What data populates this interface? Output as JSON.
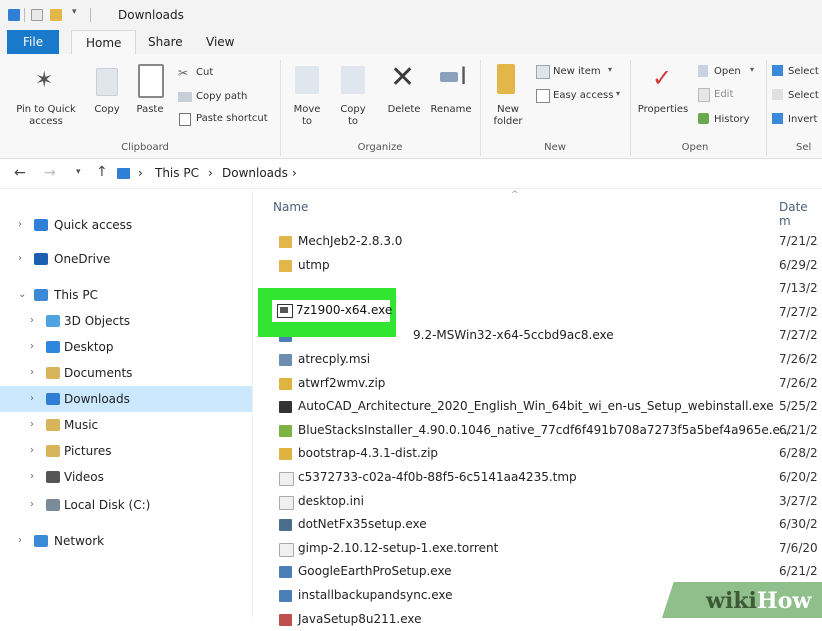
{
  "window": {
    "title": "Downloads"
  },
  "menu_tabs": [
    "File",
    "Home",
    "Share",
    "View"
  ],
  "ribbon": {
    "clipboard": {
      "pin_to_quick_access": "Pin to Quick access",
      "copy": "Copy",
      "paste": "Paste",
      "cut": "Cut",
      "copy_path": "Copy path",
      "paste_shortcut": "Paste shortcut",
      "group_label": "Clipboard"
    },
    "organize": {
      "move_to": "Move to",
      "copy_to": "Copy to",
      "delete": "Delete",
      "rename": "Rename",
      "group_label": "Organize"
    },
    "new": {
      "new_folder": "New folder",
      "new_item": "New item",
      "easy_access": "Easy access",
      "group_label": "New"
    },
    "open": {
      "properties": "Properties",
      "open": "Open",
      "edit": "Edit",
      "history": "History",
      "group_label": "Open"
    },
    "select": {
      "select_all": "Select",
      "select_none": "Select",
      "invert": "Invert",
      "group_label": "Sel"
    }
  },
  "address_bar": {
    "crumbs": [
      "This PC",
      "Downloads"
    ]
  },
  "nav_pane": [
    {
      "label": "Quick access",
      "icon": "star-icon",
      "color": "#2f7fd6"
    },
    {
      "label": "OneDrive",
      "icon": "cloud-icon",
      "color": "#1c5fb0"
    },
    {
      "label": "This PC",
      "icon": "computer-icon",
      "color": "#3b8ad8"
    },
    {
      "label": "3D Objects",
      "icon": "cube-icon",
      "color": "#4fa3e0"
    },
    {
      "label": "Desktop",
      "icon": "desktop-icon",
      "color": "#2e86de"
    },
    {
      "label": "Documents",
      "icon": "documents-icon",
      "color": "#d8b45a"
    },
    {
      "label": "Downloads",
      "icon": "downloads-icon",
      "color": "#2f7fd6"
    },
    {
      "label": "Music",
      "icon": "music-icon",
      "color": "#d8b45a"
    },
    {
      "label": "Pictures",
      "icon": "pictures-icon",
      "color": "#d8b45a"
    },
    {
      "label": "Videos",
      "icon": "videos-icon",
      "color": "#555555"
    },
    {
      "label": "Local Disk (C:)",
      "icon": "disk-icon",
      "color": "#7a8a99"
    },
    {
      "label": "Network",
      "icon": "network-icon",
      "color": "#3b8ad8"
    }
  ],
  "file_list": {
    "columns": {
      "name": "Name",
      "date": "Date m"
    },
    "rows": [
      {
        "name": "MechJeb2-2.8.3.0",
        "date": "7/21/2",
        "icon": "folder-icon",
        "color": "#e3b64a"
      },
      {
        "name": "utmp",
        "date": "6/29/2",
        "icon": "folder-icon",
        "color": "#e3b64a"
      },
      {
        "name": "",
        "date": "7/13/2",
        "icon": "",
        "color": "#ffffff"
      },
      {
        "name": "",
        "date": "7/27/2",
        "icon": "",
        "color": "#ffffff"
      },
      {
        "name": "9.2-MSWin32-x64-5ccbd9ac8.exe",
        "date": "7/27/2",
        "icon": "exe-icon",
        "color": "#4a7fb5"
      },
      {
        "name": "atrecply.msi",
        "date": "7/26/2",
        "icon": "installer-icon",
        "color": "#6b8fb0"
      },
      {
        "name": "atwrf2wmv.zip",
        "date": "7/26/2",
        "icon": "zip-icon",
        "color": "#e0b23f"
      },
      {
        "name": "AutoCAD_Architecture_2020_English_Win_64bit_wi_en-us_Setup_webinstall.exe",
        "date": "5/25/2",
        "icon": "download-arrow-icon",
        "color": "#333333"
      },
      {
        "name": "BlueStacksInstaller_4.90.0.1046_native_77cdf6f491b708a7273f5a5bef4a965e.e...",
        "date": "6/21/2",
        "icon": "bluestacks-icon",
        "color": "#7cb342"
      },
      {
        "name": "bootstrap-4.3.1-dist.zip",
        "date": "6/28/2",
        "icon": "zip-icon",
        "color": "#e0b23f"
      },
      {
        "name": "c5372733-c02a-4f0b-88f5-6c5141aa4235.tmp",
        "date": "6/20/2",
        "icon": "file-icon",
        "color": "#f0f0f0"
      },
      {
        "name": "desktop.ini",
        "date": "3/27/2",
        "icon": "ini-icon",
        "color": "#f0f0f0"
      },
      {
        "name": "dotNetFx35setup.exe",
        "date": "6/30/2",
        "icon": "dotnet-icon",
        "color": "#4a6d8c"
      },
      {
        "name": "gimp-2.10.12-setup-1.exe.torrent",
        "date": "7/6/20",
        "icon": "file-icon",
        "color": "#f0f0f0"
      },
      {
        "name": "GoogleEarthProSetup.exe",
        "date": "6/21/2",
        "icon": "setup-icon",
        "color": "#4a7fb5"
      },
      {
        "name": "installbackupandsync.exe",
        "date": "",
        "icon": "setup-icon",
        "color": "#4a7fb5"
      },
      {
        "name": "JavaSetup8u211.exe",
        "date": "",
        "icon": "java-icon",
        "color": "#c0504d"
      }
    ]
  },
  "highlighted_file": {
    "name": "7z1900-x64.exe",
    "accent": "#31e531"
  },
  "watermark": {
    "part1": "wiki",
    "part2": "How"
  },
  "colors": {
    "file_tab": "#1979ca",
    "selection": "#cce8ff"
  }
}
